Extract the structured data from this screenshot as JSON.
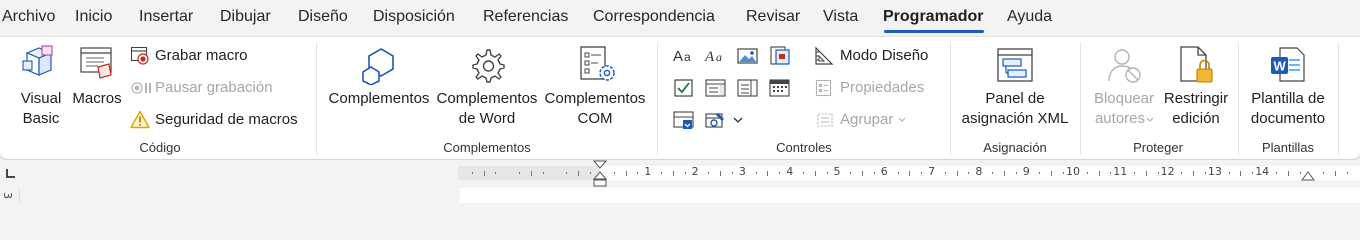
{
  "tabs": [
    {
      "label": "Archivo"
    },
    {
      "label": "Inicio"
    },
    {
      "label": "Insertar"
    },
    {
      "label": "Dibujar"
    },
    {
      "label": "Diseño"
    },
    {
      "label": "Disposición"
    },
    {
      "label": "Referencias"
    },
    {
      "label": "Correspondencia"
    },
    {
      "label": "Revisar"
    },
    {
      "label": "Vista"
    },
    {
      "label": "Programador"
    },
    {
      "label": "Ayuda"
    }
  ],
  "active_tab": "Programador",
  "colors": {
    "accent": "#185abd",
    "warning": "#e8a200",
    "record": "#c42b1c",
    "word_blue": "#185abd"
  },
  "groups": {
    "codigo": {
      "label": "Código",
      "visual_basic_l1": "Visual",
      "visual_basic_l2": "Basic",
      "macros": "Macros",
      "grabar_macro": "Grabar macro",
      "pausar_grabacion": "Pausar grabación",
      "seguridad_macros": "Seguridad de macros"
    },
    "complementos": {
      "label": "Complementos",
      "complementos": "Complementos",
      "word_l1": "Complementos",
      "word_l2": "de Word",
      "com_l1": "Complementos",
      "com_l2": "COM"
    },
    "controles": {
      "label": "Controles",
      "modo_diseno": "Modo Diseño",
      "propiedades": "Propiedades",
      "agrupar": "Agrupar"
    },
    "asignacion": {
      "label": "Asignación",
      "panel_l1": "Panel de",
      "panel_l2": "asignación XML"
    },
    "proteger": {
      "label": "Proteger",
      "bloquear_l1": "Bloquear",
      "bloquear_l2": "autores",
      "restringir_l1": "Restringir",
      "restringir_l2": "edición"
    },
    "plantillas": {
      "label": "Plantillas",
      "plantilla_l1": "Plantilla de",
      "plantilla_l2": "documento"
    }
  },
  "ruler": {
    "numbers": [
      "1",
      "2",
      "3",
      "4",
      "5",
      "6",
      "7",
      "8",
      "9",
      "10",
      "11",
      "12",
      "13",
      "14"
    ],
    "vertical_number": "3"
  }
}
